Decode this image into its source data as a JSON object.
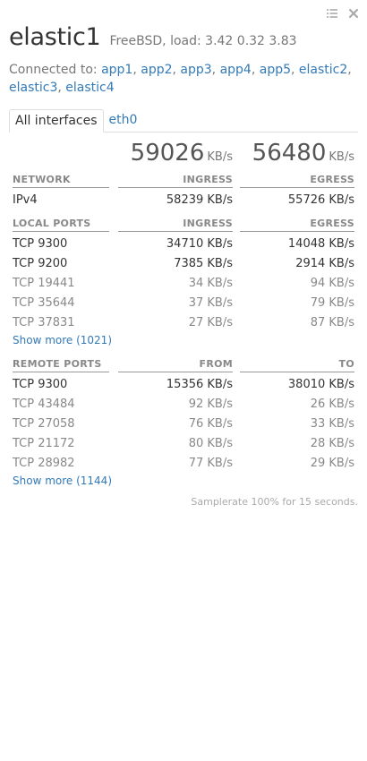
{
  "window": {
    "icons": [
      "list-icon",
      "close-icon"
    ]
  },
  "header": {
    "hostname": "elastic1",
    "sysinfo": "FreeBSD, load: 3.42 0.32 3.83"
  },
  "connected": {
    "label": "Connected to:",
    "hosts": [
      "app1",
      "app2",
      "app3",
      "app4",
      "app5",
      "elastic2",
      "elastic3",
      "elastic4"
    ]
  },
  "tabs": [
    {
      "label": "All interfaces",
      "active": true
    },
    {
      "label": "eth0",
      "active": false
    }
  ],
  "totals": {
    "ingress": "59026",
    "egress": "56480",
    "unit": "KB/s"
  },
  "network": {
    "headers": [
      "NETWORK",
      "INGRESS",
      "EGRESS"
    ],
    "rows": [
      {
        "name": "IPv4",
        "c1": "58239 KB/s",
        "c2": "55726 KB/s"
      }
    ]
  },
  "local_ports": {
    "headers": [
      "LOCAL PORTS",
      "INGRESS",
      "EGRESS"
    ],
    "rows": [
      {
        "name": "TCP 9300",
        "c1": "34710 KB/s",
        "c2": "14048 KB/s"
      },
      {
        "name": "TCP 9200",
        "c1": "7385 KB/s",
        "c2": "2914 KB/s"
      },
      {
        "name": "TCP 19441",
        "c1": "34 KB/s",
        "c2": "94 KB/s"
      },
      {
        "name": "TCP 35644",
        "c1": "37 KB/s",
        "c2": "79 KB/s"
      },
      {
        "name": "TCP 37831",
        "c1": "27 KB/s",
        "c2": "87 KB/s"
      }
    ],
    "show_more": "Show more (1021)"
  },
  "remote_ports": {
    "headers": [
      "REMOTE PORTS",
      "FROM",
      "TO"
    ],
    "rows": [
      {
        "name": "TCP 9300",
        "c1": "15356 KB/s",
        "c2": "38010 KB/s"
      },
      {
        "name": "TCP 43484",
        "c1": "92 KB/s",
        "c2": "26 KB/s"
      },
      {
        "name": "TCP 27058",
        "c1": "76 KB/s",
        "c2": "33 KB/s"
      },
      {
        "name": "TCP 21172",
        "c1": "80 KB/s",
        "c2": "28 KB/s"
      },
      {
        "name": "TCP 28982",
        "c1": "77 KB/s",
        "c2": "29 KB/s"
      }
    ],
    "show_more": "Show more (1144)"
  },
  "footer": {
    "text": "Samplerate 100% for 15 seconds."
  }
}
